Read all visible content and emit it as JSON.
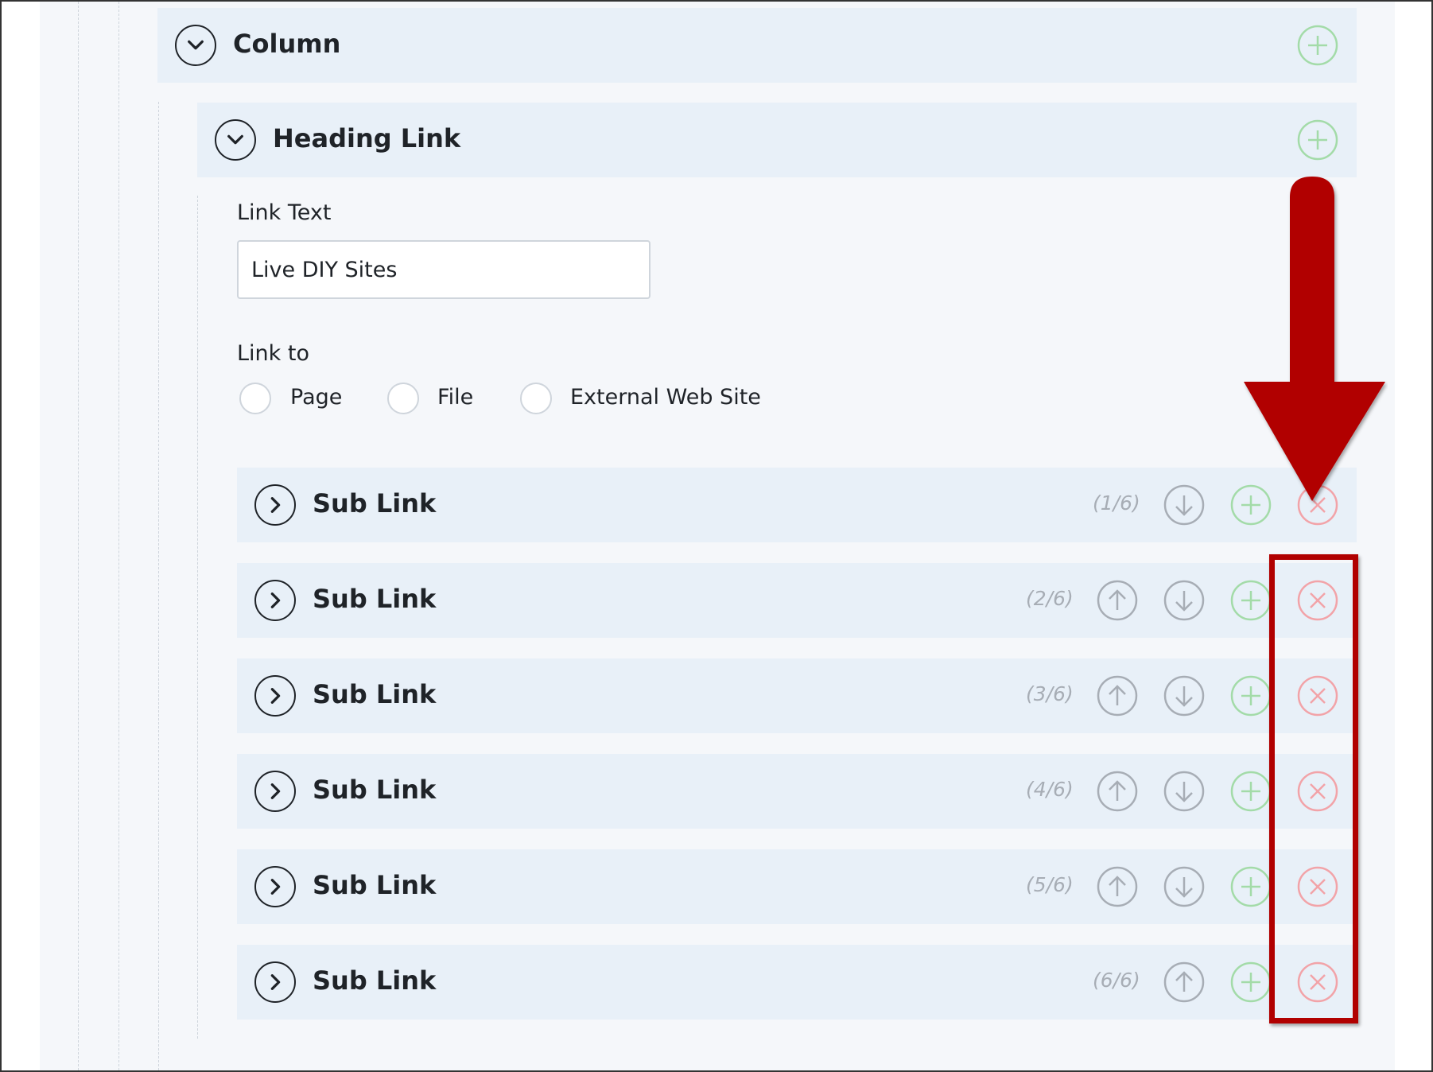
{
  "column": {
    "title": "Column"
  },
  "heading_link": {
    "title": "Heading Link",
    "link_text_label": "Link Text",
    "link_text_value": "Live DIY Sites",
    "link_to_label": "Link to",
    "link_to_options": [
      "Page",
      "File",
      "External Web Site"
    ]
  },
  "sub_links": [
    {
      "title": "Sub Link",
      "counter": "(1/6)"
    },
    {
      "title": "Sub Link",
      "counter": "(2/6)"
    },
    {
      "title": "Sub Link",
      "counter": "(3/6)"
    },
    {
      "title": "Sub Link",
      "counter": "(4/6)"
    },
    {
      "title": "Sub Link",
      "counter": "(5/6)"
    },
    {
      "title": "Sub Link",
      "counter": "(6/6)"
    }
  ],
  "colors": {
    "panel_bg": "#e8f0f8",
    "add_green": "#a3dba8",
    "remove_red": "#f2a3a8",
    "move_gray": "#a7adb5",
    "annotation_red": "#b10000"
  }
}
